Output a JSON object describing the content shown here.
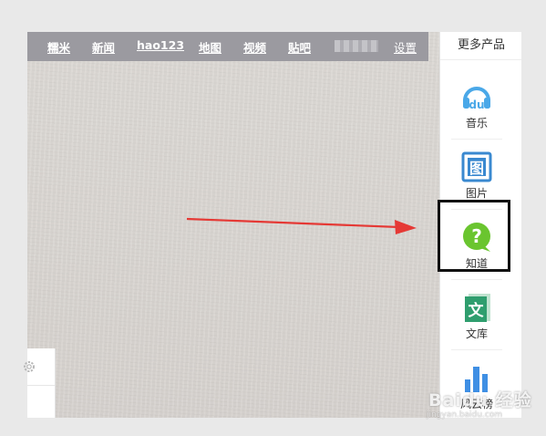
{
  "topnav": {
    "links": [
      "糯米",
      "新闻",
      "hao123",
      "地图",
      "视频",
      "贴吧"
    ],
    "settings_label": "设置"
  },
  "sidebar": {
    "title": "更多产品",
    "items": [
      {
        "label": "音乐",
        "icon": "music-du-icon"
      },
      {
        "label": "图片",
        "icon": "image-icon"
      },
      {
        "label": "知道",
        "icon": "question-bubble-icon"
      },
      {
        "label": "文库",
        "icon": "document-wen-icon"
      },
      {
        "label": "风云榜",
        "icon": "bar-chart-icon"
      }
    ]
  },
  "icons": {
    "music_glyph": "du",
    "image_glyph": "图",
    "question_glyph": "?",
    "document_glyph": "文"
  },
  "colors": {
    "nav_bg": "#9b9aa0",
    "music": "#4aa8e8",
    "image": "#3a89d0",
    "question": "#6ac52f",
    "document": "#2f9e6e",
    "chart": "#3f8fe4",
    "arrow": "#e53935",
    "highlight": "#111111"
  },
  "watermark": {
    "brand": "Baidu 经验",
    "url": "jingyan.baidu.com"
  }
}
